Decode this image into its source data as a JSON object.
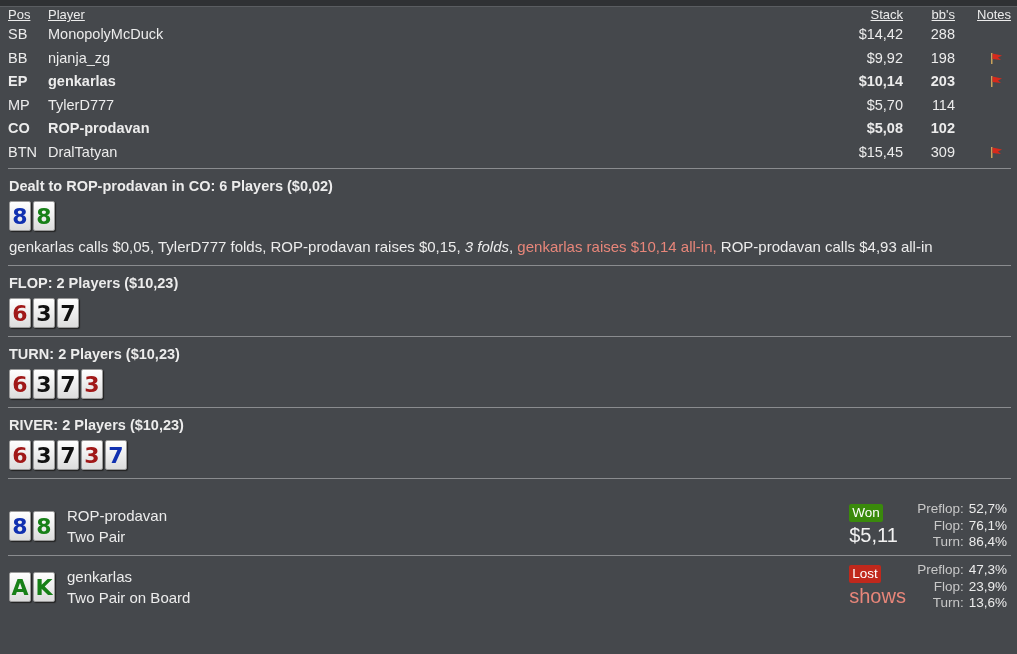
{
  "players": {
    "columns": [
      "Pos",
      "Player",
      "Stack",
      "bb's",
      "Notes"
    ],
    "rows": [
      {
        "pos": "SB",
        "player": "MonopolyMcDuck",
        "stack": "$14,42",
        "bbs": "288",
        "highlighted": false,
        "note": false
      },
      {
        "pos": "BB",
        "player": "njanja_zg",
        "stack": "$9,92",
        "bbs": "198",
        "highlighted": false,
        "note": true
      },
      {
        "pos": "EP",
        "player": "genkarlas",
        "stack": "$10,14",
        "bbs": "203",
        "highlighted": true,
        "note": true
      },
      {
        "pos": "MP",
        "player": "TylerD777",
        "stack": "$5,70",
        "bbs": "114",
        "highlighted": false,
        "note": false
      },
      {
        "pos": "CO",
        "player": "ROP-prodavan",
        "stack": "$5,08",
        "bbs": "102",
        "highlighted": true,
        "note": false
      },
      {
        "pos": "BTN",
        "player": "DralTatyan",
        "stack": "$15,45",
        "bbs": "309",
        "highlighted": false,
        "note": true
      }
    ]
  },
  "streets": [
    {
      "title": "Dealt to ROP-prodavan in CO: 6 Players ($0,02)",
      "cards": [
        {
          "rank": "8",
          "color": "#1030b0"
        },
        {
          "rank": "8",
          "color": "#178017"
        }
      ],
      "actions": [
        {
          "kind": "plain",
          "text": "genkarlas calls $0,05, TylerD777 folds, ROP-prodavan raises $0,15, "
        },
        {
          "kind": "italic",
          "text": "3 folds"
        },
        {
          "kind": "plain",
          "text": ", "
        },
        {
          "kind": "aggressive",
          "text": "genkarlas raises $10,14 all-in,"
        },
        {
          "kind": "plain",
          "text": " ROP-prodavan calls $4,93 all-in"
        }
      ]
    },
    {
      "title": "FLOP: 2 Players ($10,23)",
      "cards": [
        {
          "rank": "6",
          "color": "#a01818"
        },
        {
          "rank": "3",
          "color": "#111111"
        },
        {
          "rank": "7",
          "color": "#111111"
        }
      ]
    },
    {
      "title": "TURN: 2 Players ($10,23)",
      "cards": [
        {
          "rank": "6",
          "color": "#a01818"
        },
        {
          "rank": "3",
          "color": "#111111"
        },
        {
          "rank": "7",
          "color": "#111111"
        },
        {
          "rank": "3",
          "color": "#a01818"
        }
      ]
    },
    {
      "title": "RIVER: 2 Players ($10,23)",
      "cards": [
        {
          "rank": "6",
          "color": "#a01818"
        },
        {
          "rank": "3",
          "color": "#111111"
        },
        {
          "rank": "7",
          "color": "#111111"
        },
        {
          "rank": "3",
          "color": "#a01818"
        },
        {
          "rank": "7",
          "color": "#1030b0"
        }
      ]
    }
  ],
  "results": [
    {
      "cards": [
        {
          "rank": "8",
          "color": "#1030b0"
        },
        {
          "rank": "8",
          "color": "#178017"
        }
      ],
      "player": "ROP-prodavan",
      "hand": "Two Pair",
      "kind": "won",
      "badge": "Won",
      "amount": "$5,11",
      "equity": [
        {
          "label": "Preflop:",
          "value": "52,7%"
        },
        {
          "label": "Flop:",
          "value": "76,1%"
        },
        {
          "label": "Turn:",
          "value": "86,4%"
        }
      ]
    },
    {
      "cards": [
        {
          "rank": "A",
          "color": "#178017"
        },
        {
          "rank": "K",
          "color": "#178017"
        }
      ],
      "player": "genkarlas",
      "hand": "Two Pair on Board",
      "kind": "lost",
      "badge": "Lost",
      "amount": "shows",
      "equity": [
        {
          "label": "Preflop:",
          "value": "47,3%"
        },
        {
          "label": "Flop:",
          "value": "23,9%"
        },
        {
          "label": "Turn:",
          "value": "13,6%"
        }
      ]
    }
  ]
}
